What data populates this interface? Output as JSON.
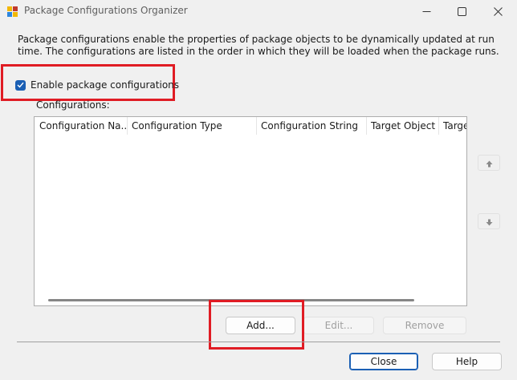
{
  "window": {
    "title": "Package Configurations Organizer",
    "icon": "package-config-icon",
    "controls": [
      "minimize-icon",
      "maximize-icon",
      "close-icon"
    ]
  },
  "description": "Package configurations enable the properties of package objects to be dynamically updated at run time. The configurations are listed in the order in which they will be loaded when the package runs.",
  "enable": {
    "label": "Enable package configurations",
    "checked": true
  },
  "configurations": {
    "label": "Configurations:",
    "columns": [
      "Configuration Na...",
      "Configuration Type",
      "Configuration String",
      "Target Object",
      "Targe"
    ],
    "rows": []
  },
  "side_buttons": {
    "up_icon": "move-up-icon",
    "down_icon": "move-down-icon"
  },
  "actions": {
    "add": "Add...",
    "edit": "Edit...",
    "remove": "Remove"
  },
  "footer": {
    "close": "Close",
    "help": "Help"
  },
  "colors": {
    "accent": "#1a5fb4",
    "highlight": "#e01c24"
  }
}
